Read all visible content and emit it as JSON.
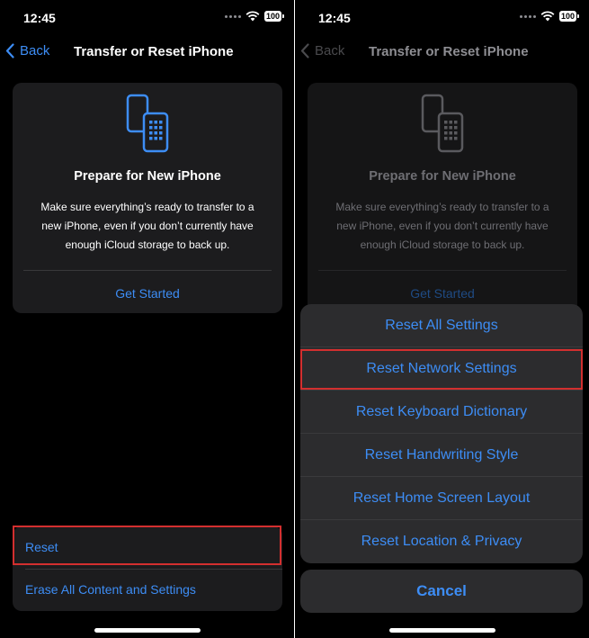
{
  "colors": {
    "accent": "#3d8df5",
    "highlight": "#d32f2f",
    "background": "#000000",
    "card": "#1c1c1e"
  },
  "left": {
    "status": {
      "time": "12:45",
      "battery": "100"
    },
    "nav": {
      "back_label": "Back",
      "title": "Transfer or Reset iPhone"
    },
    "card": {
      "icon": "iphone-transfer-icon",
      "title": "Prepare for New iPhone",
      "desc_lines": [
        "Make sure everything’s ready to transfer to a",
        "new iPhone, even if you don’t currently have",
        "enough iCloud storage to back up."
      ],
      "link": "Get Started"
    },
    "reset_group": {
      "reset": "Reset",
      "erase": "Erase All Content and Settings"
    }
  },
  "right": {
    "status": {
      "time": "12:45",
      "battery": "100"
    },
    "nav": {
      "back_label": "Back",
      "title": "Transfer or Reset iPhone"
    },
    "card": {
      "icon": "iphone-transfer-icon",
      "title": "Prepare for New iPhone",
      "desc_lines": [
        "Make sure everything’s ready to transfer to a",
        "new iPhone, even if you don’t currently have",
        "enough iCloud storage to back up."
      ],
      "link": "Get Started"
    },
    "sheet": {
      "items": [
        "Reset All Settings",
        "Reset Network Settings",
        "Reset Keyboard Dictionary",
        "Reset Handwriting Style",
        "Reset Home Screen Layout",
        "Reset Location & Privacy"
      ],
      "cancel": "Cancel"
    }
  }
}
